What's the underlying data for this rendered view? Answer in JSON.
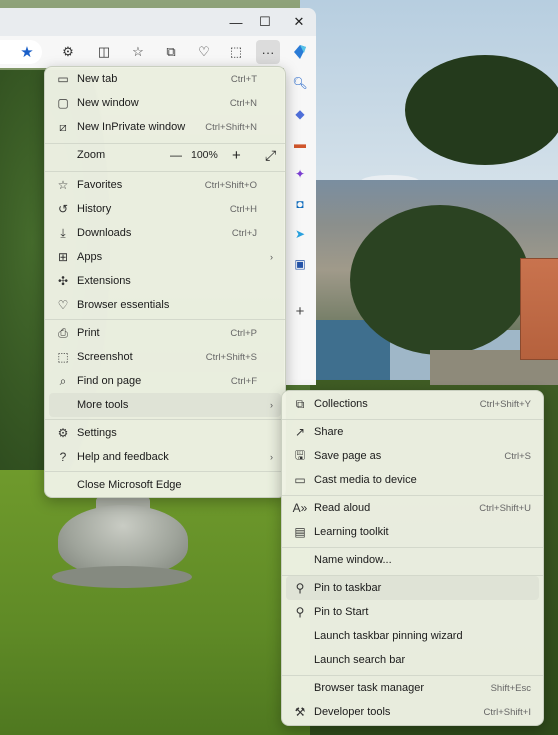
{
  "window": {
    "minimize_glyph": "—",
    "maximize_glyph": "☐",
    "close_glyph": "✕"
  },
  "toolbar": {
    "more_glyph": "···"
  },
  "main_menu": {
    "new_tab": {
      "label": "New tab",
      "shortcut": "Ctrl+T"
    },
    "new_window": {
      "label": "New window",
      "shortcut": "Ctrl+N"
    },
    "new_inprivate": {
      "label": "New InPrivate window",
      "shortcut": "Ctrl+Shift+N"
    },
    "zoom": {
      "label": "Zoom",
      "minus": "—",
      "value": "100%",
      "plus": "+",
      "fullscreen": "⤢"
    },
    "favorites": {
      "label": "Favorites",
      "shortcut": "Ctrl+Shift+O"
    },
    "history": {
      "label": "History",
      "shortcut": "Ctrl+H"
    },
    "downloads": {
      "label": "Downloads",
      "shortcut": "Ctrl+J"
    },
    "apps": {
      "label": "Apps"
    },
    "extensions": {
      "label": "Extensions"
    },
    "browser_essentials": {
      "label": "Browser essentials"
    },
    "print": {
      "label": "Print",
      "shortcut": "Ctrl+P"
    },
    "screenshot": {
      "label": "Screenshot",
      "shortcut": "Ctrl+Shift+S"
    },
    "find_on_page": {
      "label": "Find on page",
      "shortcut": "Ctrl+F"
    },
    "more_tools": {
      "label": "More tools"
    },
    "settings": {
      "label": "Settings"
    },
    "help": {
      "label": "Help and feedback"
    },
    "close_edge": {
      "label": "Close Microsoft Edge"
    },
    "submenu_arrow": "›"
  },
  "more_tools_menu": {
    "collections": {
      "label": "Collections",
      "shortcut": "Ctrl+Shift+Y"
    },
    "share": {
      "label": "Share"
    },
    "save_page_as": {
      "label": "Save page as",
      "shortcut": "Ctrl+S"
    },
    "cast_media": {
      "label": "Cast media to device"
    },
    "read_aloud": {
      "label": "Read aloud",
      "shortcut": "Ctrl+Shift+U"
    },
    "learning_toolkit": {
      "label": "Learning toolkit"
    },
    "name_window": {
      "label": "Name window..."
    },
    "pin_to_taskbar": {
      "label": "Pin to taskbar"
    },
    "pin_to_start": {
      "label": "Pin to Start"
    },
    "launch_pinning_wizard": {
      "label": "Launch taskbar pinning wizard"
    },
    "launch_search_bar": {
      "label": "Launch search bar"
    },
    "task_manager": {
      "label": "Browser task manager",
      "shortcut": "Shift+Esc"
    },
    "developer_tools": {
      "label": "Developer tools",
      "shortcut": "Ctrl+Shift+I"
    }
  },
  "sidebar": {
    "add_glyph": "+"
  }
}
